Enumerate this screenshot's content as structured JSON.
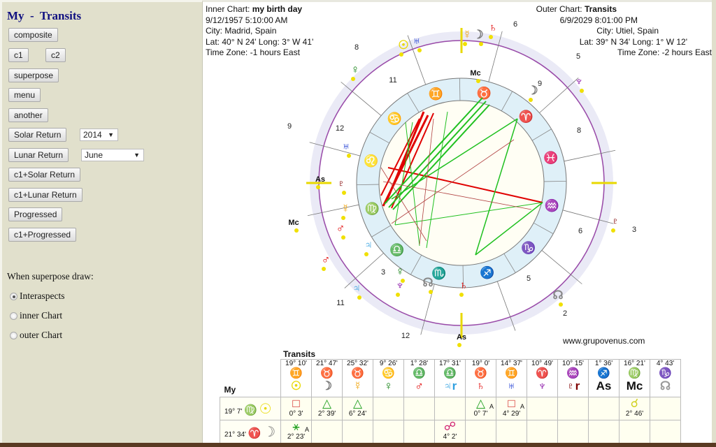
{
  "sidebar": {
    "title": "My  -  Transits",
    "buttons": [
      "composite",
      "c1",
      "c2",
      "superpose",
      "menu",
      "another",
      "Solar Return",
      "Lunar Return",
      "c1+Solar Return",
      "c1+Lunar Return",
      "Progressed",
      "c1+Progressed"
    ],
    "solar_year": "2014",
    "lunar_month": "June",
    "superpose_label": "When superpose draw:",
    "radios": [
      {
        "label": "Interaspects",
        "checked": true
      },
      {
        "label": "inner Chart",
        "checked": false
      },
      {
        "label": "outer Chart",
        "checked": false
      }
    ]
  },
  "inner": {
    "label": "Inner Chart: ",
    "name": "my birth day",
    "date": "9/12/1957 5:10:00 AM",
    "city": "City: Madrid, Spain",
    "latlong": "Lat: 40° N 24'  Long: 3° W 41'",
    "tz": "Time Zone: -1 hours East"
  },
  "outer": {
    "label": "Outer Chart: ",
    "name": "Transits",
    "date": "6/9/2029 8:01:00 PM",
    "city": "City: Utiel, Spain",
    "latlong": "Lat: 39° N 34'  Long: 1° W 12'",
    "tz": "Time Zone: -2 hours East"
  },
  "wheel": {
    "signs": [
      "♈",
      "♉",
      "♊",
      "♋",
      "♌",
      "♍",
      "♎",
      "♏",
      "♐",
      "♑",
      "♒",
      "♓"
    ],
    "inner_houses": [
      "12",
      "11",
      "9",
      "8",
      "6",
      "5",
      "3"
    ],
    "outer_houses": [
      "8",
      "6",
      "5",
      "9",
      "3",
      "2",
      "11",
      "12"
    ],
    "planets": [
      {
        "g": "☉",
        "c": "#e8d800"
      },
      {
        "g": "♅",
        "c": "#1030d0"
      },
      {
        "g": "☿",
        "c": "#f0a000"
      },
      {
        "g": "☽",
        "c": "#777"
      },
      {
        "g": "♄",
        "c": "#e00000"
      },
      {
        "g": "Mc",
        "c": "#111"
      },
      {
        "g": "♀",
        "c": "#108010"
      },
      {
        "g": "♆",
        "c": "#8000a0"
      },
      {
        "g": "☽",
        "c": "#777"
      },
      {
        "g": "♅",
        "c": "#1030d0"
      },
      {
        "g": "As",
        "c": "#111"
      },
      {
        "g": "♇",
        "c": "#800000"
      },
      {
        "g": "☿",
        "c": "#f0a000"
      },
      {
        "g": "♂",
        "c": "#e00000"
      },
      {
        "g": "♃",
        "c": "#30a0e0"
      },
      {
        "g": "♀",
        "c": "#108010"
      },
      {
        "g": "♆",
        "c": "#8000a0"
      },
      {
        "g": "☊",
        "c": "#888"
      },
      {
        "g": "♄",
        "c": "#e00000"
      },
      {
        "g": "Mc",
        "c": "#111"
      },
      {
        "g": "♂",
        "c": "#e00000"
      },
      {
        "g": "♃",
        "c": "#30a0e0"
      },
      {
        "g": "♇",
        "c": "#800000"
      },
      {
        "g": "☊",
        "c": "#888"
      },
      {
        "g": "As",
        "c": "#111"
      }
    ],
    "credit": "www.grupovenus.com"
  },
  "table": {
    "title": "Transits",
    "corner": "My",
    "columns": [
      {
        "deg": "19° 10'",
        "sign": "♊",
        "planet": "☉",
        "color": "#e8d800"
      },
      {
        "deg": "21° 47'",
        "sign": "♉",
        "planet": "☽",
        "color": "#777"
      },
      {
        "deg": "25° 32'",
        "sign": "♉",
        "planet": "☿",
        "color": "#f0a000"
      },
      {
        "deg": "9° 26'",
        "sign": "♋",
        "planet": "♀",
        "color": "#108010"
      },
      {
        "deg": "1° 28'",
        "sign": "♎",
        "planet": "♂",
        "color": "#e00000"
      },
      {
        "deg": "17° 31'",
        "sign": "♎",
        "planet": "♃r",
        "color": "#30a0e0"
      },
      {
        "deg": "19° 0'",
        "sign": "♉",
        "planet": "♄",
        "color": "#e00000"
      },
      {
        "deg": "14° 37'",
        "sign": "♊",
        "planet": "♅",
        "color": "#1030d0"
      },
      {
        "deg": "10° 49'",
        "sign": "♈",
        "planet": "♆",
        "color": "#8000a0"
      },
      {
        "deg": "10° 15'",
        "sign": "♒",
        "planet": "♇r",
        "color": "#800000"
      },
      {
        "deg": "1° 36'",
        "sign": "♐",
        "planet": "As",
        "color": "#111"
      },
      {
        "deg": "16° 21'",
        "sign": "♍",
        "planet": "Mc",
        "color": "#111"
      },
      {
        "deg": "4° 43'",
        "sign": "♑",
        "planet": "☊",
        "color": "#999"
      }
    ],
    "rows": [
      {
        "deg": "19° 7'",
        "sign": "♍",
        "planet": "☉",
        "color": "#e8d800",
        "cells": [
          {
            "a": "□",
            "o": "0° 3'",
            "c": "#d02020"
          },
          {
            "a": "△",
            "o": "2° 39'",
            "c": "#20a020"
          },
          {
            "a": "△",
            "o": "6° 24'",
            "c": "#20a020"
          },
          {},
          {},
          {},
          {
            "a": "△",
            "o": "0° 7'",
            "c": "#20a020",
            "x": "A"
          },
          {
            "a": "□",
            "o": "4° 29'",
            "c": "#d02020",
            "x": "A"
          },
          {},
          {},
          {},
          {
            "a": "☌",
            "o": "2° 46'",
            "c": "#d0d020"
          },
          {}
        ]
      },
      {
        "deg": "21° 34'",
        "sign": "♈",
        "planet": "☽",
        "color": "#777",
        "cells": [
          {
            "a": "⚹",
            "o": "2° 23'",
            "c": "#20a020",
            "x": "A"
          },
          {},
          {},
          {},
          {},
          {
            "a": "☍",
            "o": "4° 2'",
            "c": "#d02070"
          },
          {},
          {},
          {},
          {},
          {},
          {},
          {}
        ]
      }
    ]
  }
}
